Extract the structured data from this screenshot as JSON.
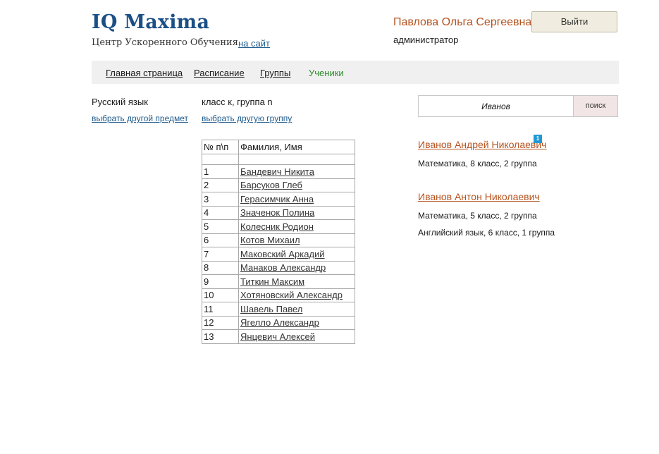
{
  "header": {
    "logo": "IQ Maxima",
    "subtitle": "Центр Ускоренного Обучения",
    "site_link": "на сайт",
    "user_name": "Павлова Ольга Сергеевна",
    "user_role": "администратор",
    "logout_label": "Выйти"
  },
  "nav": {
    "items": [
      {
        "label": "Главная страница"
      },
      {
        "label": "Расписание"
      },
      {
        "label": "Группы"
      },
      {
        "label": "Ученики",
        "active": true
      }
    ]
  },
  "main": {
    "subject": "Русский язык",
    "group": "класс к, группа n",
    "change_subject": "выбрать другой предмет",
    "change_group": "выбрать другую группу",
    "table": {
      "headers": [
        "№ п\\п",
        "Фамилия, Имя"
      ],
      "rows": [
        {
          "num": "1",
          "name": "Бандевич Никита"
        },
        {
          "num": "2",
          "name": "Барсуков Глеб"
        },
        {
          "num": "3",
          "name": "Герасимчик Анна"
        },
        {
          "num": "4",
          "name": "Значенок Полина"
        },
        {
          "num": "5",
          "name": "Колесник Родион"
        },
        {
          "num": "6",
          "name": "Котов Михаил"
        },
        {
          "num": "7",
          "name": "Маковский Аркадий"
        },
        {
          "num": "8",
          "name": "Манаков Александр"
        },
        {
          "num": "9",
          "name": "Титкин Максим"
        },
        {
          "num": "10",
          "name": "Хотяновский Александр"
        },
        {
          "num": "11",
          "name": "Шавель Павел"
        },
        {
          "num": "12",
          "name": "Ягелло Александр"
        },
        {
          "num": "13",
          "name": "Янцевич Алексей"
        }
      ]
    }
  },
  "search": {
    "value": "Иванов",
    "button_label": "поиск"
  },
  "results": [
    {
      "name": "Иванов Андрей Николаевич",
      "badge": "1",
      "details": [
        "Математика, 8 класс, 2 группа"
      ]
    },
    {
      "name": "Иванов Антон Николаевич",
      "details": [
        "Математика, 5 класс, 2 группа",
        "Английский язык, 6 класс, 1 группа"
      ]
    }
  ],
  "colors": {
    "logo": "#1b4f86",
    "user_name": "#b5531f",
    "nav_active": "#2e8b2e",
    "link": "#1e5b8c",
    "badge": "#1f9ad6"
  }
}
